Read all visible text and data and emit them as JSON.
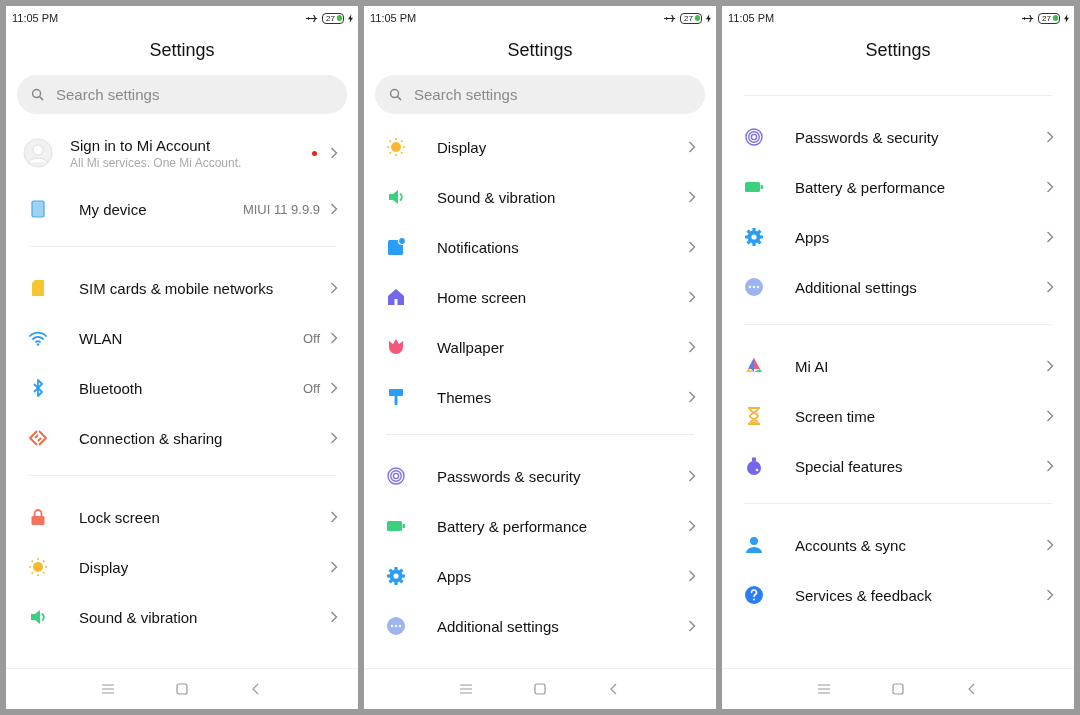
{
  "screens": [
    {
      "status_bar": {
        "time": "11:05 PM",
        "battery": "27"
      },
      "title": "Settings",
      "search": {
        "placeholder": "Search settings"
      },
      "sections": [
        [
          {
            "kind": "account",
            "label": "Sign in to Mi Account",
            "subtitle": "All Mi services. One Mi Account.",
            "notification": true
          },
          {
            "kind": "item",
            "label": "My device",
            "value": "MIUI 11 9.9.9"
          }
        ],
        [
          {
            "kind": "item",
            "label": "SIM cards & mobile networks"
          },
          {
            "kind": "item",
            "label": "WLAN",
            "value": "Off"
          },
          {
            "kind": "item",
            "label": "Bluetooth",
            "value": "Off"
          },
          {
            "kind": "item",
            "label": "Connection & sharing"
          }
        ],
        [
          {
            "kind": "item",
            "label": "Lock screen"
          },
          {
            "kind": "item",
            "label": "Display"
          },
          {
            "kind": "item",
            "label": "Sound & vibration"
          }
        ]
      ]
    },
    {
      "status_bar": {
        "time": "11:05 PM",
        "battery": "27"
      },
      "title": "Settings",
      "search": {
        "placeholder": "Search settings"
      },
      "sections": [
        [
          {
            "kind": "item",
            "label": "Display"
          },
          {
            "kind": "item",
            "label": "Sound & vibration"
          },
          {
            "kind": "item",
            "label": "Notifications"
          },
          {
            "kind": "item",
            "label": "Home screen"
          },
          {
            "kind": "item",
            "label": "Wallpaper"
          },
          {
            "kind": "item",
            "label": "Themes"
          }
        ],
        [
          {
            "kind": "item",
            "label": "Passwords & security"
          },
          {
            "kind": "item",
            "label": "Battery & performance"
          },
          {
            "kind": "item",
            "label": "Apps"
          },
          {
            "kind": "item",
            "label": "Additional settings"
          }
        ]
      ]
    },
    {
      "status_bar": {
        "time": "11:05 PM",
        "battery": "27"
      },
      "title": "Settings",
      "sections": [
        [
          {
            "kind": "item",
            "label": "Passwords & security"
          },
          {
            "kind": "item",
            "label": "Battery & performance"
          },
          {
            "kind": "item",
            "label": "Apps"
          },
          {
            "kind": "item",
            "label": "Additional settings"
          }
        ],
        [
          {
            "kind": "item",
            "label": "Mi AI"
          },
          {
            "kind": "item",
            "label": "Screen time"
          },
          {
            "kind": "item",
            "label": "Special features"
          }
        ],
        [
          {
            "kind": "item",
            "label": "Accounts & sync"
          },
          {
            "kind": "item",
            "label": "Services & feedback"
          }
        ]
      ]
    }
  ]
}
